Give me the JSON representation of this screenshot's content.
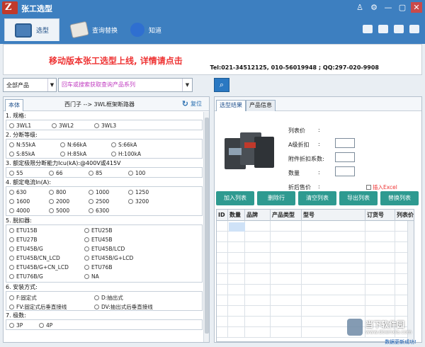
{
  "app": {
    "title": "张工选型"
  },
  "window_controls": {
    "user": "♙",
    "settings": "⚙",
    "minimize": "—",
    "restore": "▢",
    "close": "✕"
  },
  "toolbar": {
    "items": [
      {
        "label": "选型",
        "icon": "monitor-icon"
      },
      {
        "label": "查询替换",
        "icon": "book-icon"
      },
      {
        "label": "知道",
        "icon": "globe-icon"
      }
    ]
  },
  "banner": {
    "main_text": "移动版本张工选型上线, 详情请点击",
    "contact": "Tel:021-34512125, 010-56019948 ; QQ:297-020-9908"
  },
  "search": {
    "product_select": "全部产品",
    "placeholder": "回车或搜索获取查询产品系列",
    "search_icon": "⌕"
  },
  "left_panel": {
    "tab": "本体",
    "breadcrumb": "西门子 --> 3WL框架断路器",
    "reset_label": "复位",
    "sections": [
      {
        "title": "1. 规格:",
        "options": [
          "3WL1",
          "3WL2",
          "3WL3"
        ]
      },
      {
        "title": "2. 分断等级:",
        "options": [
          "N:55kA",
          "N:66kA",
          "S:66kA",
          "S:85kA",
          "H:85kA",
          "H:100kA"
        ]
      },
      {
        "title": "3. 额定极限分断能力Icu(kA):@400V或415V",
        "options": [
          "55",
          "66",
          "85",
          "100"
        ]
      },
      {
        "title": "4. 额定电流In(A):",
        "options": [
          "630",
          "800",
          "1000",
          "1250",
          "1600",
          "2000",
          "2500",
          "3200",
          "4000",
          "5000",
          "6300"
        ]
      },
      {
        "title": "5. 脱扣器:",
        "options": [
          "ETU15B",
          "ETU25B",
          "ETU27B",
          "ETU45B",
          "ETU45B/G",
          "ETU45B/LCD",
          "ETU45B/CN_LCD",
          "ETU45B/G+LCD",
          "ETU45B/G+CN_LCD",
          "ETU76B",
          "ETU76B/G",
          "NA"
        ]
      },
      {
        "title": "6. 安装方式:",
        "options": [
          "F:固定式",
          "D:抽出式",
          "FV:固定式后垂直接线",
          "DV:抽出式后垂直接线"
        ]
      },
      {
        "title": "7. 极数:",
        "options": [
          "3P",
          "4P"
        ]
      }
    ]
  },
  "right_panel": {
    "tabs": [
      "选型结果",
      "产品信息"
    ],
    "fields": {
      "list_price": "列表价",
      "discount_a": "A级折扣",
      "extra_discount": "附件折扣系数:",
      "quantity": "数量",
      "after_price": "折后售价",
      "colon": ":"
    },
    "insert_excel": "插入Excel",
    "buttons": [
      "加入列表",
      "删除行",
      "清空列表",
      "导出列表",
      "替换列表"
    ],
    "grid_headers": [
      "ID",
      "数量",
      "品牌",
      "产品类型",
      "型号",
      "订货号",
      "列表价"
    ]
  },
  "status": {
    "text": "数据更新成功!"
  },
  "watermark": {
    "text": "当下软件园",
    "url": "www.downxia.com"
  }
}
